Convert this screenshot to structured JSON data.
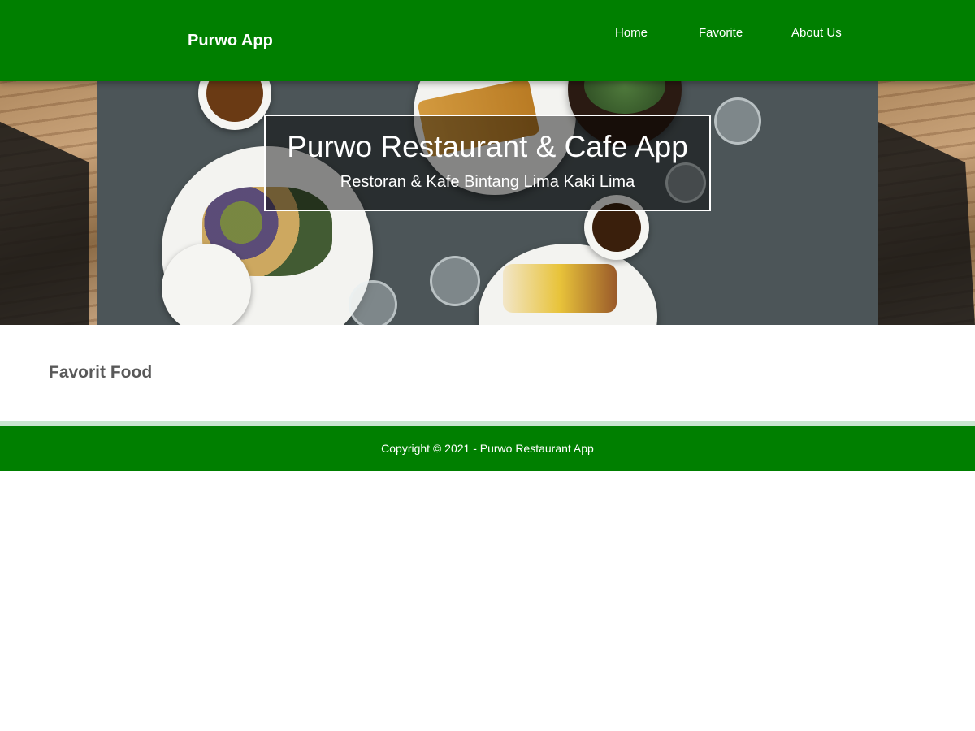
{
  "app_bar": {
    "brand": "Purwo App",
    "nav": [
      {
        "label": "Home"
      },
      {
        "label": "Favorite"
      },
      {
        "label": "About Us"
      }
    ]
  },
  "hero": {
    "title": "Purwo Restaurant & Cafe App",
    "subtitle": "Restoran & Kafe Bintang Lima Kaki Lima"
  },
  "main": {
    "section_title": "Favorit Food"
  },
  "footer": {
    "copyright": "Copyright © 2021 - Purwo Restaurant App"
  },
  "colors": {
    "primary": "#007f00",
    "text_on_primary": "#ffffff",
    "heading": "#595959"
  }
}
